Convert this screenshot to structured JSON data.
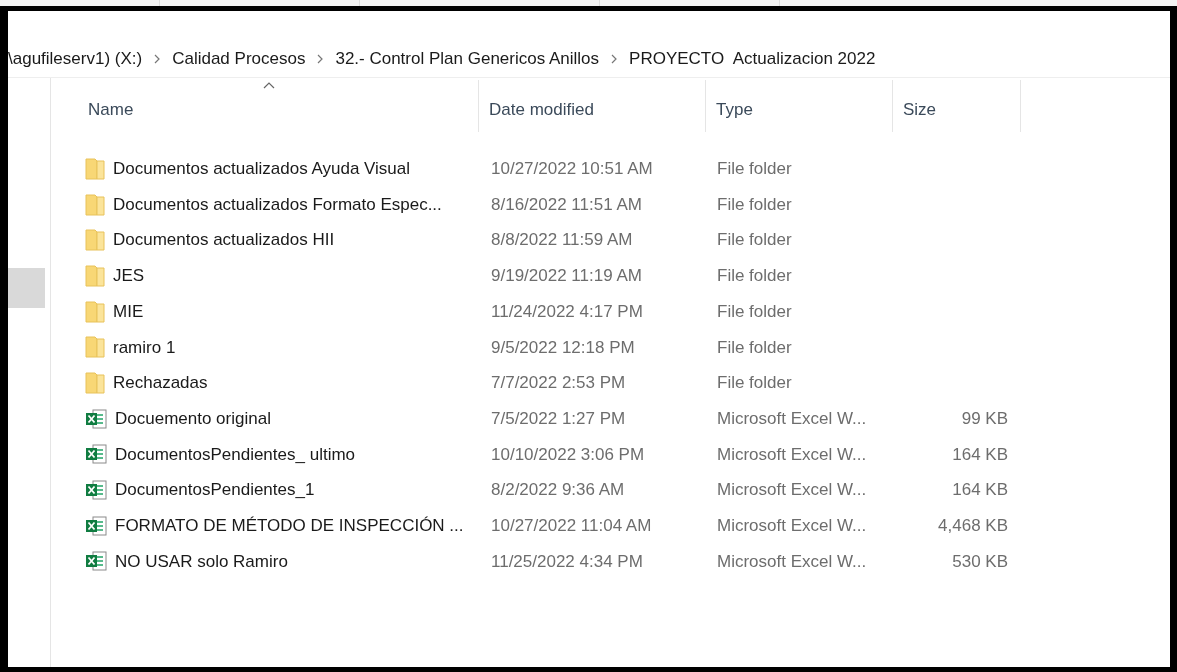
{
  "breadcrumb": [
    {
      "label": "\\agufileserv1) (X:)"
    },
    {
      "label": "Calidad Procesos"
    },
    {
      "label": "32.- Control Plan Genericos Anillos"
    },
    {
      "label": "PROYECTO  Actualizacion 2022"
    }
  ],
  "columns": [
    {
      "label": "Name",
      "sorted": true
    },
    {
      "label": "Date modified",
      "sorted": false
    },
    {
      "label": "Type",
      "sorted": false
    },
    {
      "label": "Size",
      "sorted": false
    }
  ],
  "rows": [
    {
      "kind": "folder",
      "name": "Documentos actualizados Ayuda Visual",
      "date": "10/27/2022 10:51 AM",
      "type": "File folder"
    },
    {
      "kind": "folder",
      "name": "Documentos actualizados Formato Espec...",
      "date": "8/16/2022 11:51 AM",
      "type": "File folder"
    },
    {
      "kind": "folder",
      "name": "Documentos actualizados HII",
      "date": "8/8/2022 11:59 AM",
      "type": "File folder"
    },
    {
      "kind": "folder",
      "name": "JES",
      "date": "9/19/2022 11:19 AM",
      "type": "File folder"
    },
    {
      "kind": "folder",
      "name": "MIE",
      "date": "11/24/2022 4:17 PM",
      "type": "File folder"
    },
    {
      "kind": "folder",
      "name": "ramiro 1",
      "date": "9/5/2022 12:18 PM",
      "type": "File folder"
    },
    {
      "kind": "folder",
      "name": "Rechazadas",
      "date": "7/7/2022 2:53 PM",
      "type": "File folder"
    },
    {
      "kind": "excel",
      "name": "Docuemento original",
      "date": "7/5/2022 1:27 PM",
      "type": "Microsoft Excel W...",
      "size": "99 KB"
    },
    {
      "kind": "excel",
      "name": "DocumentosPendientes_ ultimo",
      "date": "10/10/2022 3:06 PM",
      "type": "Microsoft Excel W...",
      "size": "164 KB"
    },
    {
      "kind": "excel",
      "name": "DocumentosPendientes_1",
      "date": "8/2/2022 9:36 AM",
      "type": "Microsoft Excel W...",
      "size": "164 KB"
    },
    {
      "kind": "excel",
      "name": "FORMATO DE MÉTODO DE INSPECCIÓN ...",
      "date": "10/27/2022 11:04 AM",
      "type": "Microsoft Excel W...",
      "size": "4,468 KB"
    },
    {
      "kind": "excel",
      "name": "NO USAR solo Ramiro",
      "date": "11/25/2022 4:34 PM",
      "type": "Microsoft Excel W...",
      "size": "530 KB"
    }
  ]
}
